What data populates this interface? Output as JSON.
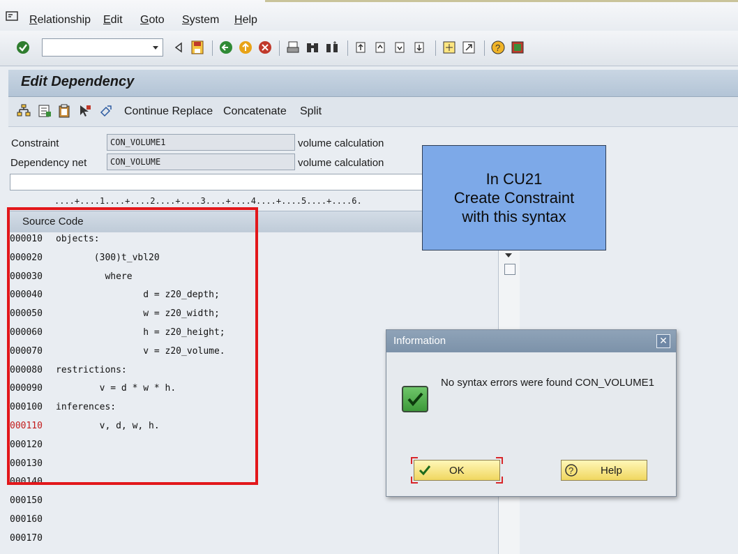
{
  "menu": [
    "Relationship",
    "Edit",
    "Goto",
    "System",
    "Help"
  ],
  "page_title": "Edit Dependency",
  "app_toolbar": {
    "continue_replace": "Continue Replace",
    "concatenate": "Concatenate",
    "split": "Split"
  },
  "form": {
    "constraint_label": "Constraint",
    "constraint_value": "CON_VOLUME1",
    "constraint_desc": "volume calculation",
    "depnet_label": "Dependency net",
    "depnet_value": "CON_VOLUME",
    "depnet_desc": "volume calculation",
    "ruler": "....+....1....+....2....+....3....+....4....+....5....+....6."
  },
  "source_code": {
    "header": "Source Code",
    "lines": [
      {
        "num": "000010",
        "text": "objects:"
      },
      {
        "num": "000020",
        "text": "       (300)t_vbl20"
      },
      {
        "num": "000030",
        "text": "         where"
      },
      {
        "num": "000040",
        "text": "                d = z20_depth;"
      },
      {
        "num": "000050",
        "text": "                w = z20_width;"
      },
      {
        "num": "000060",
        "text": "                h = z20_height;"
      },
      {
        "num": "000070",
        "text": "                v = z20_volume."
      },
      {
        "num": "000080",
        "text": "restrictions:"
      },
      {
        "num": "000090",
        "text": "        v = d * w * h."
      },
      {
        "num": "000100",
        "text": "inferences:"
      },
      {
        "num": "000110",
        "text": "        v, d, w, h."
      },
      {
        "num": "000120",
        "text": ""
      },
      {
        "num": "000130",
        "text": ""
      },
      {
        "num": "000140",
        "text": ""
      },
      {
        "num": "000150",
        "text": ""
      },
      {
        "num": "000160",
        "text": ""
      },
      {
        "num": "000170",
        "text": ""
      }
    ]
  },
  "callout": {
    "line1": "In CU21",
    "line2": "Create Constraint",
    "line3": "with this syntax"
  },
  "dialog": {
    "title": "Information",
    "message": "No syntax errors were found CON_VOLUME1",
    "ok_label": "OK",
    "help_label": "Help"
  }
}
